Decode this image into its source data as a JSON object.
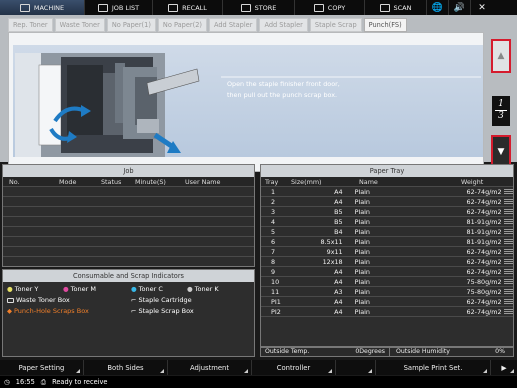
{
  "topnav": {
    "machine": "MACHINE",
    "job_list": "JOB LIST",
    "recall": "RECALL",
    "store": "STORE",
    "copy": "COPY",
    "scan": "SCAN"
  },
  "tabs": [
    "Rep. Toner",
    "Waste Toner",
    "No Paper(1)",
    "No Paper(2)",
    "Add Stapler",
    "Add Stapler",
    "Staple Scrap",
    "Punch(FS)"
  ],
  "instruction": {
    "line1": "Open the staple finisher front door,",
    "line2": "then pull out the punch scrap box."
  },
  "pager": {
    "current": "1",
    "total": "3"
  },
  "job": {
    "title": "Job",
    "columns": [
      "No.",
      "Mode",
      "Status",
      "Minute(S)",
      "User Name"
    ]
  },
  "consumables": {
    "title": "Consumable and Scrap Indicators",
    "toner_y": "Toner Y",
    "toner_m": "Toner M",
    "toner_c": "Toner C",
    "toner_k": "Toner K",
    "waste_toner": "Waste Toner Box",
    "staple_cartridge": "Staple Cartridge",
    "punch_scraps": "Punch-Hole Scraps Box",
    "staple_scrap": "Staple Scrap Box"
  },
  "paper_tray": {
    "title": "Paper Tray",
    "columns": [
      "Tray",
      "Size(mm)",
      "Name",
      "Weight"
    ],
    "rows": [
      {
        "tray": "1",
        "size": "A4",
        "name": "Plain",
        "weight": "62-74g/m2"
      },
      {
        "tray": "2",
        "size": "A4",
        "name": "Plain",
        "weight": "62-74g/m2"
      },
      {
        "tray": "3",
        "size": "B5",
        "name": "Plain",
        "weight": "62-74g/m2"
      },
      {
        "tray": "4",
        "size": "B5",
        "name": "Plain",
        "weight": "81-91g/m2"
      },
      {
        "tray": "5",
        "size": "B4",
        "name": "Plain",
        "weight": "81-91g/m2"
      },
      {
        "tray": "6",
        "size": "8.5x11",
        "name": "Plain",
        "weight": "81-91g/m2"
      },
      {
        "tray": "7",
        "size": "9x11",
        "name": "Plain",
        "weight": "62-74g/m2"
      },
      {
        "tray": "8",
        "size": "12x18",
        "name": "Plain",
        "weight": "62-74g/m2"
      },
      {
        "tray": "9",
        "size": "A4",
        "name": "Plain",
        "weight": "62-74g/m2"
      },
      {
        "tray": "10",
        "size": "A4",
        "name": "Plain",
        "weight": "75-80g/m2"
      },
      {
        "tray": "11",
        "size": "A3",
        "name": "Plain",
        "weight": "75-80g/m2"
      },
      {
        "tray": "PI1",
        "size": "A4",
        "name": "Plain",
        "weight": "62-74g/m2"
      },
      {
        "tray": "PI2",
        "size": "A4",
        "name": "Plain",
        "weight": "62-74g/m2"
      }
    ],
    "outside_temp_label": "Outside Temp.",
    "outside_temp_value": "0Degrees",
    "outside_humidity_label": "Outside Humidity",
    "outside_humidity_value": "0%"
  },
  "bottombar": {
    "paper_setting": "Paper Setting",
    "both_sides": "Both Sides",
    "adjustment": "Adjustment",
    "controller": "Controller",
    "sample_print": "Sample Print Set."
  },
  "status": {
    "time": "16:55",
    "message": "Ready to receive"
  },
  "colors": {
    "alert_red": "#d51b2d",
    "highlight_orange": "#f07f2a",
    "panel_header": "#cfd3d7"
  }
}
